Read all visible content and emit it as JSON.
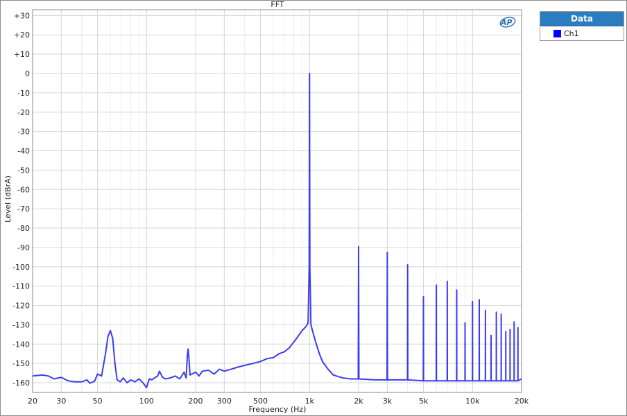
{
  "window": {
    "title": "FFT"
  },
  "legend": {
    "header": "Data",
    "items": [
      {
        "label": "Ch1",
        "color": "#0000ff"
      }
    ]
  },
  "logo": {
    "text": "AP",
    "icon": "ap-logo-icon",
    "color": "#2a6fb5"
  },
  "colors": {
    "trace": "#3b3bf2",
    "plot_bg": "#ffffff",
    "grid": "#d9d9d9",
    "legend_header": "#2a7ec0"
  },
  "chart_data": {
    "type": "line",
    "title": "FFT",
    "xlabel": "Frequency (Hz)",
    "ylabel": "Level (dBrA)",
    "xscale": "log",
    "xlim": [
      20,
      20000
    ],
    "ylim": [
      -165,
      33
    ],
    "grid": true,
    "legend_position": "top-right, outside plot",
    "x_ticks": [
      {
        "value": 20,
        "label": "20"
      },
      {
        "value": 30,
        "label": "30"
      },
      {
        "value": 50,
        "label": "50"
      },
      {
        "value": 100,
        "label": "100"
      },
      {
        "value": 200,
        "label": "200"
      },
      {
        "value": 300,
        "label": "300"
      },
      {
        "value": 500,
        "label": "500"
      },
      {
        "value": 1000,
        "label": "1k"
      },
      {
        "value": 2000,
        "label": "2k"
      },
      {
        "value": 3000,
        "label": "3k"
      },
      {
        "value": 5000,
        "label": "5k"
      },
      {
        "value": 10000,
        "label": "10k"
      },
      {
        "value": 20000,
        "label": "20k"
      }
    ],
    "y_ticks": [
      {
        "value": 30,
        "label": "+30"
      },
      {
        "value": 20,
        "label": "+20"
      },
      {
        "value": 10,
        "label": "+10"
      },
      {
        "value": 0,
        "label": "0"
      },
      {
        "value": -10,
        "label": "-10"
      },
      {
        "value": -20,
        "label": "-20"
      },
      {
        "value": -30,
        "label": "-30"
      },
      {
        "value": -40,
        "label": "-40"
      },
      {
        "value": -50,
        "label": "-50"
      },
      {
        "value": -60,
        "label": "-60"
      },
      {
        "value": -70,
        "label": "-70"
      },
      {
        "value": -80,
        "label": "-80"
      },
      {
        "value": -90,
        "label": "-90"
      },
      {
        "value": -100,
        "label": "-100"
      },
      {
        "value": -110,
        "label": "-110"
      },
      {
        "value": -120,
        "label": "-120"
      },
      {
        "value": -130,
        "label": "-130"
      },
      {
        "value": -140,
        "label": "-140"
      },
      {
        "value": -150,
        "label": "-150"
      },
      {
        "value": -160,
        "label": "-160"
      }
    ],
    "series": [
      {
        "name": "Ch1",
        "color": "#3b3bf2",
        "points": [
          [
            20,
            -156.5
          ],
          [
            23,
            -156
          ],
          [
            25,
            -156.5
          ],
          [
            27,
            -158
          ],
          [
            30,
            -157.2
          ],
          [
            33,
            -159
          ],
          [
            36,
            -159.5
          ],
          [
            40,
            -159.5
          ],
          [
            43,
            -158.5
          ],
          [
            45,
            -160.2
          ],
          [
            48,
            -159.2
          ],
          [
            50,
            -155.5
          ],
          [
            53,
            -156.5
          ],
          [
            56,
            -145
          ],
          [
            58,
            -136
          ],
          [
            60,
            -133
          ],
          [
            62,
            -137
          ],
          [
            64,
            -150
          ],
          [
            66,
            -158.5
          ],
          [
            69,
            -159.5
          ],
          [
            72,
            -157.5
          ],
          [
            76,
            -160
          ],
          [
            80,
            -158.5
          ],
          [
            85,
            -159.5
          ],
          [
            90,
            -158
          ],
          [
            95,
            -160
          ],
          [
            100,
            -162.5
          ],
          [
            104,
            -158
          ],
          [
            108,
            -158.5
          ],
          [
            112,
            -157.5
          ],
          [
            117,
            -156.5
          ],
          [
            120,
            -154
          ],
          [
            125,
            -157
          ],
          [
            130,
            -158
          ],
          [
            140,
            -157.5
          ],
          [
            150,
            -156.5
          ],
          [
            160,
            -158
          ],
          [
            170,
            -154.5
          ],
          [
            175,
            -157.5
          ],
          [
            178,
            -146
          ],
          [
            180,
            -142.5
          ],
          [
            182,
            -147
          ],
          [
            185,
            -156
          ],
          [
            190,
            -155.5
          ],
          [
            200,
            -154.5
          ],
          [
            210,
            -156.5
          ],
          [
            220,
            -154
          ],
          [
            240,
            -153.5
          ],
          [
            260,
            -155.5
          ],
          [
            280,
            -153
          ],
          [
            300,
            -154
          ],
          [
            330,
            -153
          ],
          [
            360,
            -152
          ],
          [
            400,
            -151
          ],
          [
            450,
            -150
          ],
          [
            500,
            -149
          ],
          [
            550,
            -147.5
          ],
          [
            600,
            -147
          ],
          [
            650,
            -145
          ],
          [
            700,
            -144
          ],
          [
            750,
            -142
          ],
          [
            800,
            -139
          ],
          [
            850,
            -136
          ],
          [
            900,
            -133
          ],
          [
            950,
            -131
          ],
          [
            980,
            -129
          ],
          [
            995,
            -100
          ],
          [
            1000,
            0
          ],
          [
            1005,
            -100
          ],
          [
            1020,
            -130
          ],
          [
            1050,
            -134
          ],
          [
            1100,
            -140
          ],
          [
            1150,
            -145
          ],
          [
            1200,
            -149
          ],
          [
            1300,
            -153
          ],
          [
            1400,
            -156
          ],
          [
            1600,
            -157.5
          ],
          [
            1800,
            -158
          ],
          [
            1990,
            -158
          ],
          [
            2000,
            -89.5
          ],
          [
            2010,
            -158
          ],
          [
            2500,
            -158.5
          ],
          [
            2990,
            -158.5
          ],
          [
            3000,
            -92.5
          ],
          [
            3010,
            -158.5
          ],
          [
            3990,
            -158.5
          ],
          [
            4000,
            -99
          ],
          [
            4010,
            -158.5
          ],
          [
            4990,
            -159
          ],
          [
            5000,
            -115.5
          ],
          [
            5010,
            -159
          ],
          [
            5990,
            -159
          ],
          [
            6000,
            -109.5
          ],
          [
            6010,
            -159
          ],
          [
            6990,
            -159
          ],
          [
            7000,
            -107.5
          ],
          [
            7010,
            -159
          ],
          [
            7990,
            -159
          ],
          [
            8000,
            -112
          ],
          [
            8010,
            -159
          ],
          [
            8990,
            -159
          ],
          [
            9000,
            -129
          ],
          [
            9010,
            -159
          ],
          [
            9990,
            -159
          ],
          [
            10000,
            -118
          ],
          [
            10010,
            -159
          ],
          [
            10990,
            -159
          ],
          [
            11000,
            -117
          ],
          [
            11010,
            -159
          ],
          [
            11990,
            -159
          ],
          [
            12000,
            -122.5
          ],
          [
            12010,
            -159
          ],
          [
            12990,
            -159
          ],
          [
            13000,
            -135.5
          ],
          [
            13010,
            -159
          ],
          [
            13990,
            -159
          ],
          [
            14000,
            -123.5
          ],
          [
            14010,
            -159
          ],
          [
            14990,
            -159
          ],
          [
            15000,
            -124.5
          ],
          [
            15010,
            -159
          ],
          [
            15990,
            -159
          ],
          [
            16000,
            -133.5
          ],
          [
            16010,
            -159
          ],
          [
            16990,
            -159
          ],
          [
            17000,
            -132.5
          ],
          [
            17010,
            -159
          ],
          [
            17990,
            -159
          ],
          [
            18000,
            -128.5
          ],
          [
            18010,
            -159
          ],
          [
            18990,
            -159
          ],
          [
            19000,
            -131.5
          ],
          [
            19010,
            -159
          ],
          [
            20000,
            -158
          ]
        ]
      }
    ]
  }
}
